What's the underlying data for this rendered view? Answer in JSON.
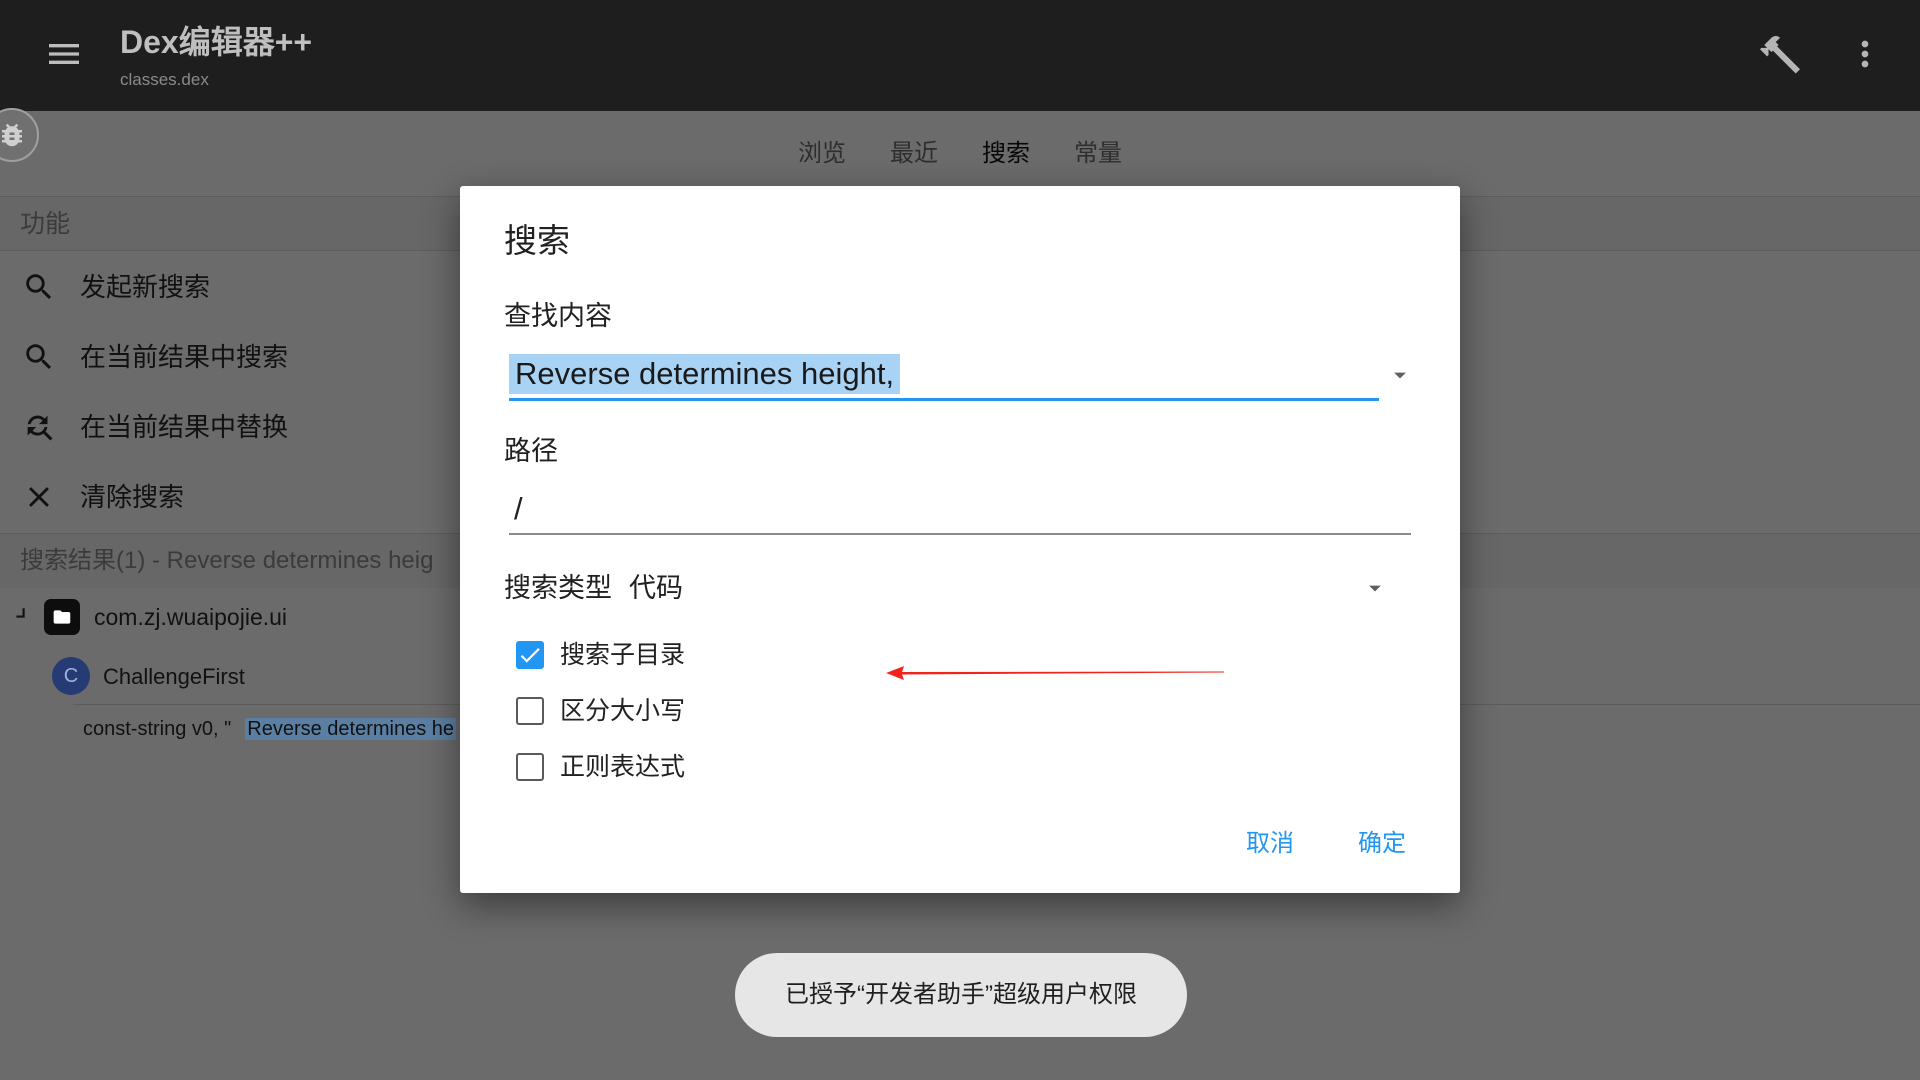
{
  "app_bar": {
    "title": "Dex编辑器++",
    "subtitle": "classes.dex",
    "menu_icon": "hamburger-menu-icon",
    "build_icon": "hammer-icon",
    "overflow_icon": "more-vert-icon"
  },
  "floating_icon": "bug-icon",
  "tabs": [
    {
      "label": "浏览",
      "selected": false
    },
    {
      "label": "最近",
      "selected": false
    },
    {
      "label": "搜索",
      "selected": true
    },
    {
      "label": "常量",
      "selected": false
    }
  ],
  "functions": {
    "header": "功能",
    "items": [
      {
        "label": "发起新搜索",
        "icon": "search-icon"
      },
      {
        "label": "在当前结果中搜索",
        "icon": "search-icon"
      },
      {
        "label": "在当前结果中替换",
        "icon": "find-replace-icon"
      },
      {
        "label": "清除搜索",
        "icon": "close-icon"
      }
    ]
  },
  "results": {
    "header": "搜索结果(1) - Reverse determines heig",
    "package": {
      "name": "com.zj.wuaipojie.ui",
      "icon": "folder-icon"
    },
    "class": {
      "badge": "C",
      "name": "ChallengeFirst"
    },
    "match": {
      "prefix": "const-string v0, \"",
      "highlight": "Reverse determines he"
    }
  },
  "dialog": {
    "title": "搜索",
    "find": {
      "label": "查找内容",
      "value": "Reverse determines height,",
      "icon": "dropdown-arrow-icon"
    },
    "path": {
      "label": "路径",
      "value": "/"
    },
    "search_type": {
      "label": "搜索类型",
      "value": "代码",
      "icon": "dropdown-arrow-icon"
    },
    "options": [
      {
        "label": "搜索子目录",
        "checked": true
      },
      {
        "label": "区分大小写",
        "checked": false
      },
      {
        "label": "正则表达式",
        "checked": false
      }
    ],
    "cancel_label": "取消",
    "ok_label": "确定"
  },
  "toast": {
    "text": "已授予“开发者助手”超级用户权限"
  },
  "colors": {
    "accent": "#2196F3",
    "annotation_arrow": "#F2231B",
    "app_bar": "#1E1E1E",
    "class_badge": "#263A73"
  }
}
